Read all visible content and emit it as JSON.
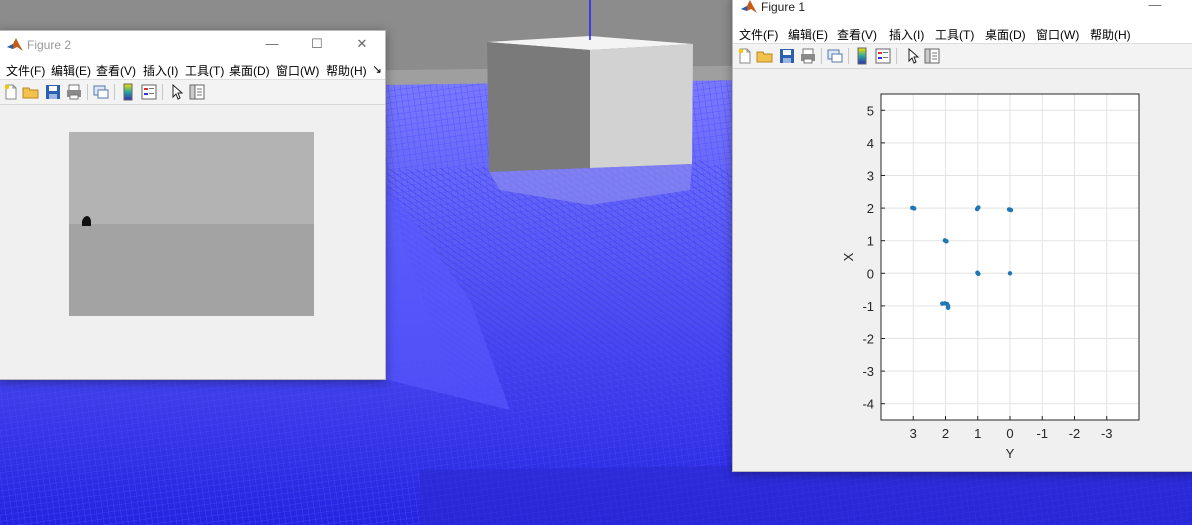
{
  "colors": {
    "scene_blue": "#3b3bff",
    "floor_gray": "#a9a9a9",
    "plot_point": "#1f77b4",
    "window_bg": "#f0f0f0"
  },
  "figure2": {
    "title": "Figure 2",
    "menus": [
      "文件(F)",
      "编辑(E)",
      "查看(V)",
      "插入(I)",
      "工具(T)",
      "桌面(D)",
      "窗口(W)",
      "帮助(H)"
    ],
    "overflow_glyph": "↘",
    "toolbar_icons": [
      "new-file-icon",
      "open-folder-icon",
      "save-icon",
      "print-icon",
      "link-figure-icon",
      "colorbar-icon",
      "legend-icon",
      "pointer-icon",
      "property-editor-icon"
    ],
    "controls": {
      "minimize": "—",
      "maximize": "☐",
      "close": "✕"
    }
  },
  "figure1": {
    "title": "Figure 1",
    "menus": [
      "文件(F)",
      "编辑(E)",
      "查看(V)",
      "插入(I)",
      "工具(T)",
      "桌面(D)",
      "窗口(W)",
      "帮助(H)"
    ],
    "toolbar_icons": [
      "new-file-icon",
      "open-folder-icon",
      "save-icon",
      "print-icon",
      "link-figure-icon",
      "colorbar-icon",
      "legend-icon",
      "pointer-icon",
      "property-editor-icon"
    ],
    "controls": {
      "minimize": "—"
    }
  },
  "chart_data": {
    "type": "scatter",
    "title": "",
    "xlabel": "Y",
    "ylabel": "X",
    "xlim": [
      4,
      -4
    ],
    "ylim": [
      -4.5,
      5.5
    ],
    "x_ticks": [
      "3",
      "2",
      "1",
      "0",
      "-1",
      "-2",
      "-3"
    ],
    "x_tick_values": [
      3,
      2,
      1,
      0,
      -1,
      -2,
      -3
    ],
    "y_ticks": [
      "5",
      "4",
      "3",
      "2",
      "1",
      "0",
      "-1",
      "-2",
      "-3",
      "-4"
    ],
    "y_tick_values": [
      5,
      4,
      3,
      2,
      1,
      0,
      -1,
      -2,
      -3,
      -4
    ],
    "grid": true,
    "x_direction": "reversed",
    "series": [
      {
        "points": [
          [
            3.0,
            2.0
          ],
          [
            2.97,
            1.99
          ],
          [
            3.03,
            2.01
          ],
          [
            1.0,
            2.0
          ],
          [
            1.02,
            1.97
          ],
          [
            0.98,
            2.02
          ],
          [
            0.0,
            1.95
          ],
          [
            -0.03,
            1.94
          ],
          [
            0.03,
            1.96
          ],
          [
            2.0,
            1.0
          ],
          [
            1.97,
            0.98
          ],
          [
            2.02,
            1.01
          ],
          [
            1.0,
            0.0
          ],
          [
            0.98,
            -0.02
          ],
          [
            1.01,
            0.02
          ],
          [
            0.0,
            0.0
          ],
          [
            2.1,
            -0.93
          ],
          [
            2.02,
            -0.92
          ],
          [
            1.95,
            -0.94
          ],
          [
            1.92,
            -1.0
          ],
          [
            1.92,
            -1.06
          ]
        ]
      }
    ]
  }
}
